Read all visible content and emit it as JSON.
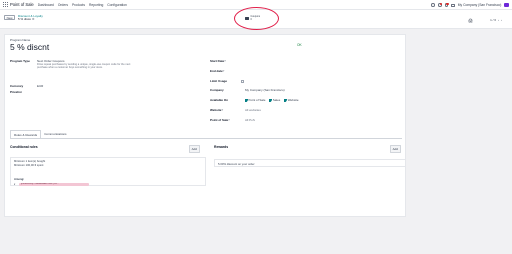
{
  "navbar": {
    "brand": "Point of Sale",
    "menu": [
      "Dashboard",
      "Orders",
      "Products",
      "Reporting",
      "Configuration"
    ],
    "company": "My Company (San Francisco)"
  },
  "control_panel": {
    "new_label": "New",
    "breadcrumb_parent": "Discount & Loyalty",
    "breadcrumb_current": "5 % disco",
    "smart_button_label": "Coupons",
    "smart_button_count": "0",
    "pager": "1 / 6"
  },
  "form": {
    "name_label": "Program Name",
    "name": "5 % discnt",
    "status": "OK",
    "program_type_label": "Program Type",
    "program_type": "Next Order Coupons",
    "program_type_help": "Drive repeat purchases by sending a unique, single-use coupon code for the next purchase when a customer buys something in your store.",
    "currency_label": "Currency",
    "currency": "EUR",
    "pricelist_label": "Pricelist",
    "start_date_label": "Start Date",
    "end_date_label": "End date",
    "limit_usage_label": "Limit Usage",
    "company_label": "Company",
    "company": "My Company (San Francisco)",
    "available_on_label": "Available On",
    "available_on": [
      "Point of Sale",
      "Sales",
      "Website"
    ],
    "website_label": "Website",
    "website": "All websites",
    "pos_label": "Point of Sale",
    "pos": "All PoS"
  },
  "tabs": [
    "Rules & Rewards",
    "Communications"
  ],
  "rules": {
    "title": "Conditional rules",
    "add_label": "Add",
    "min_qty": "Minimum 1 item(s) bought",
    "min_amount": "Minimum 100,00 € spent",
    "among_label": "Among:",
    "product": "[DESK0005] Customizable Desk (Cu..."
  },
  "rewards": {
    "title": "Rewards",
    "add_label": "Add",
    "reward": "5.00% discount on your order"
  },
  "colors": {
    "accent": "#017e84",
    "brand": "#714b67",
    "highlight": "#e11d48"
  }
}
